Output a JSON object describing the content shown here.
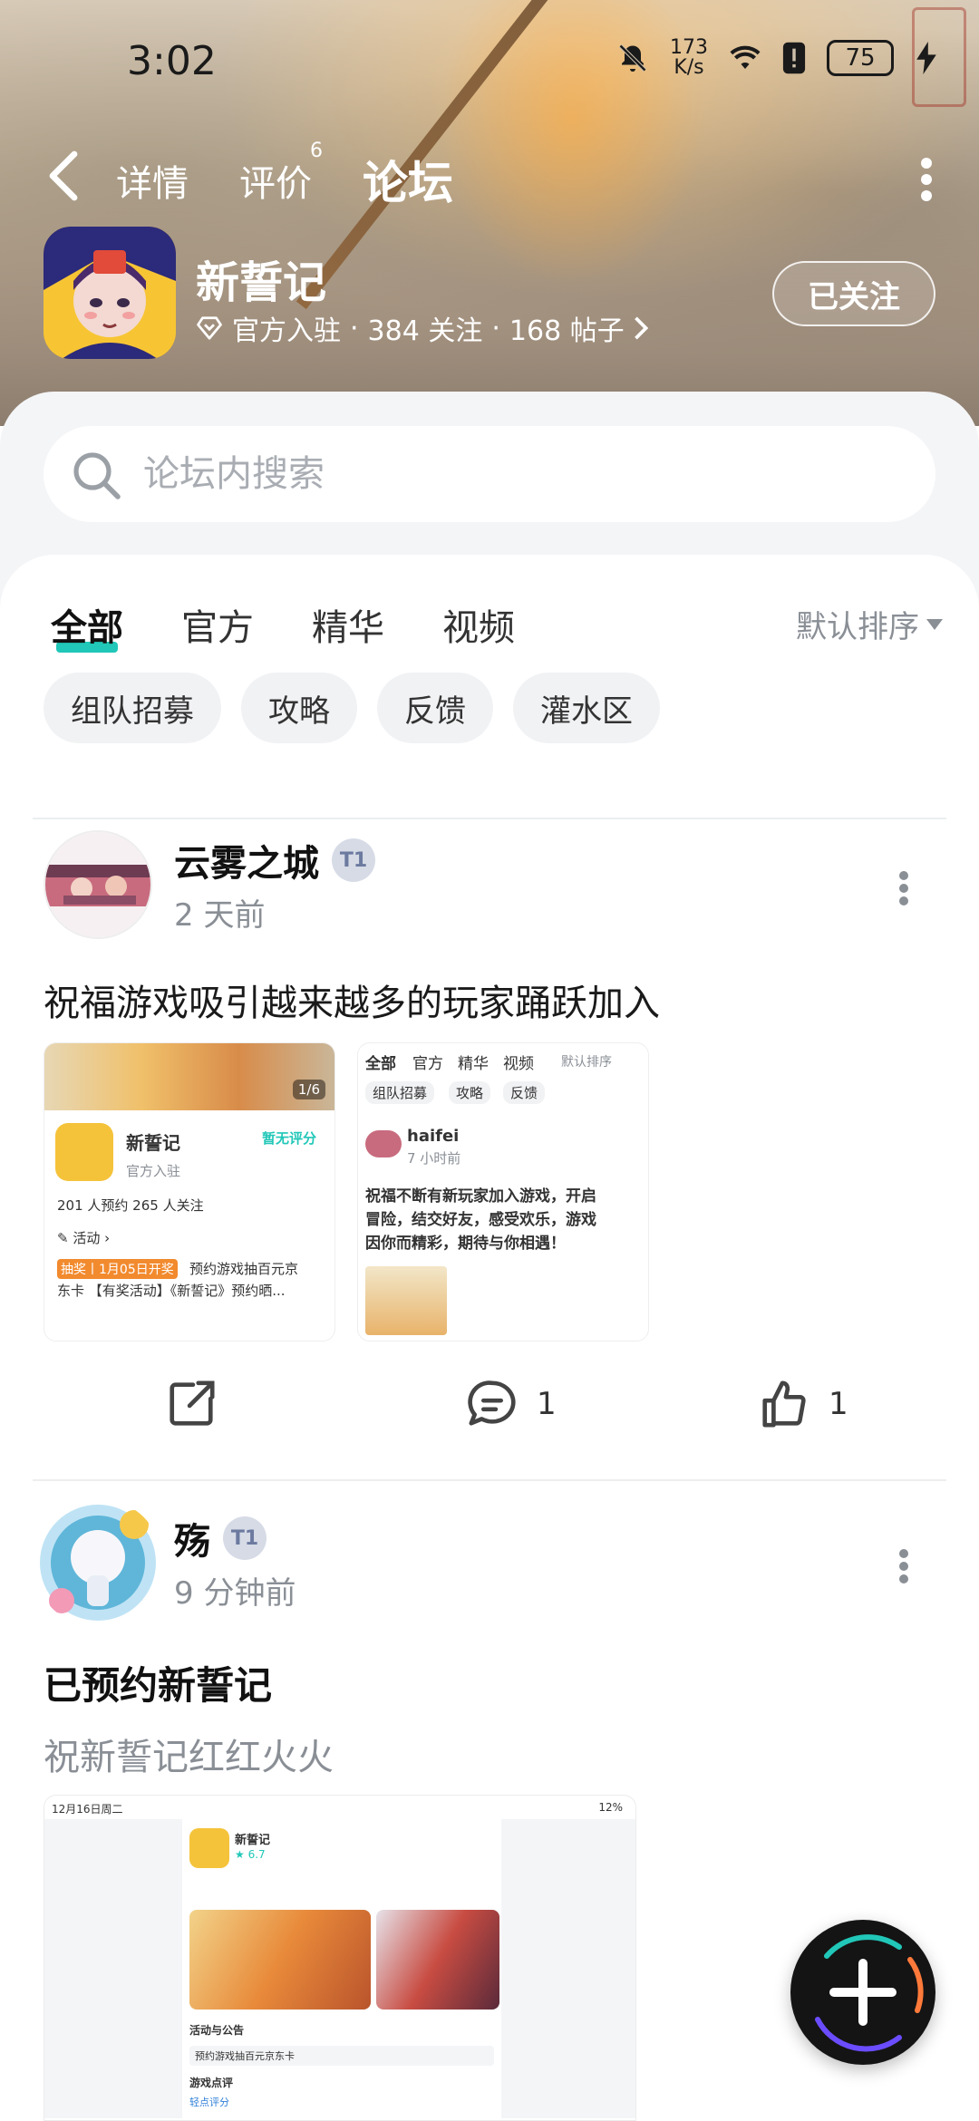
{
  "status_bar": {
    "time": "3:02",
    "net_speed_value": "173",
    "net_speed_unit": "K/s",
    "battery": "75"
  },
  "nav": {
    "tabs": [
      {
        "label": "详情"
      },
      {
        "label": "评价",
        "badge": "6"
      },
      {
        "label": "论坛"
      }
    ]
  },
  "game": {
    "name": "新誓记",
    "meta_official": "官方入驻",
    "meta_followers": "384 关注",
    "meta_posts": "168 帖子",
    "follow_label": "已关注"
  },
  "search": {
    "placeholder": "论坛内搜索"
  },
  "categories": {
    "tabs": [
      "全部",
      "官方",
      "精华",
      "视频"
    ],
    "sort_label": "默认排序"
  },
  "chips": [
    "组队招募",
    "攻略",
    "反馈",
    "灌水区"
  ],
  "posts": [
    {
      "author": "云雾之城",
      "time": "2 天前",
      "text": "祝福游戏吸引越来越多的玩家踊跃加入",
      "comments": "1",
      "likes": "1",
      "thumb1": {
        "page": "1/6",
        "name": "新誓记",
        "rating": "暂无评分",
        "official": "官方入驻",
        "stats": "201 人预约    265 人关注",
        "activity": "活动",
        "promo_tag": "抽奖丨1月05日开奖",
        "promo_line1": "预约游戏抽百元京",
        "promo_line2": "东卡 【有奖活动】《新誓记》预约晒..."
      },
      "thumb2": {
        "tabs": [
          "全部",
          "官方",
          "精华",
          "视频"
        ],
        "sort": "默认排序",
        "chips": [
          "组队招募",
          "攻略",
          "反馈"
        ],
        "author": "haifei",
        "time": "7 小时前",
        "line1": "祝福不断有新玩家加入游戏，开启",
        "line2": "冒险，结交好友，感受欢乐，游戏",
        "line3": "因你而精彩，期待与你相遇！"
      }
    },
    {
      "author": "殇",
      "time": "9 分钟前",
      "title": "已预约新誓记",
      "subtitle": "祝新誓记红红火火",
      "thumb": {
        "status_time": "12月16日周二",
        "battery": "12%",
        "name": "新誓记",
        "rating": "6.7",
        "section1": "活动与公告",
        "promo": "预约游戏抽百元京东卡",
        "section2": "游戏点评",
        "rate_label": "轻点评分"
      }
    }
  ],
  "colors": {
    "accent": "#21c7b8",
    "panel_bg": "#f4f5f7",
    "muted_text": "#8a8f96"
  }
}
